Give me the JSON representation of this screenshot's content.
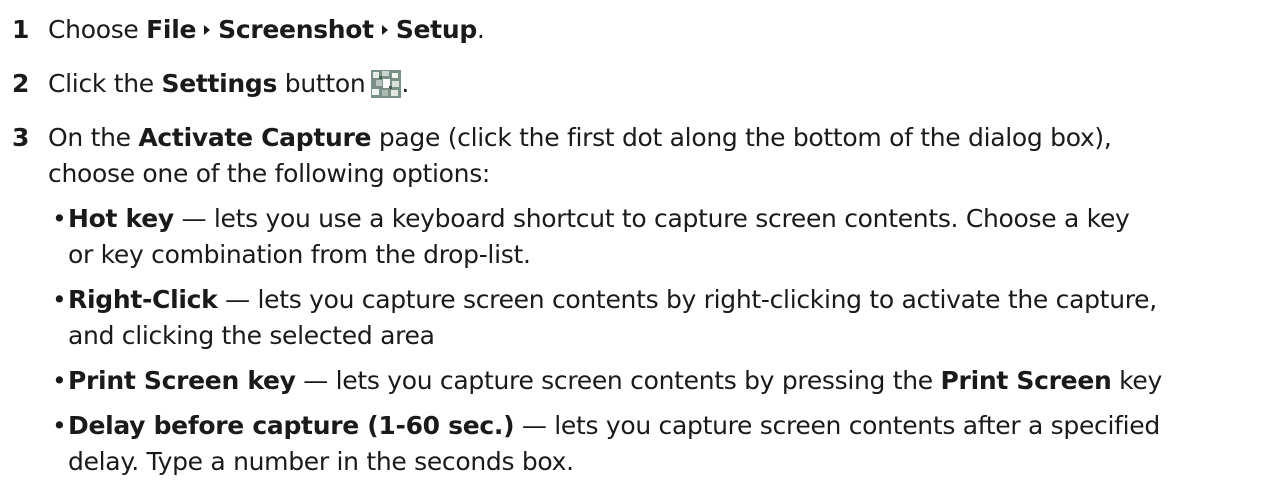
{
  "steps": [
    {
      "num": "1",
      "prefix": "Choose ",
      "menu": [
        "File",
        "Screenshot",
        "Setup"
      ],
      "suffix": "."
    },
    {
      "num": "2",
      "prefix": "Click the ",
      "bold": "Settings",
      "middle": " button",
      "suffix": ".",
      "icon": "settings-icon"
    },
    {
      "num": "3",
      "prefix": "On the ",
      "bold": "Activate Capture",
      "line1_rest": " page (click the first dot along the bottom of the dialog box),",
      "line2": "choose one of the following options:"
    }
  ],
  "options": [
    {
      "bullet": "•",
      "term": "Hot key",
      "line1_rest": " — lets you use a keyboard shortcut to capture screen contents. Choose a key",
      "line2": "or key combination from the drop-list."
    },
    {
      "bullet": "•",
      "term": "Right-Click",
      "line1_rest": " — lets you capture screen contents by right-clicking to activate the capture,",
      "line2": "and clicking the selected area"
    },
    {
      "bullet": "•",
      "term": "Print Screen key",
      "line1_rest": " — lets you capture screen contents by pressing the ",
      "bold_tail": "Print Screen",
      "tail": " key"
    },
    {
      "bullet": "•",
      "term": "Delay before capture (1-60 sec.)",
      "line1_rest": " — lets you capture screen contents after a specified",
      "line2": "delay. Type a number in the seconds box."
    }
  ]
}
